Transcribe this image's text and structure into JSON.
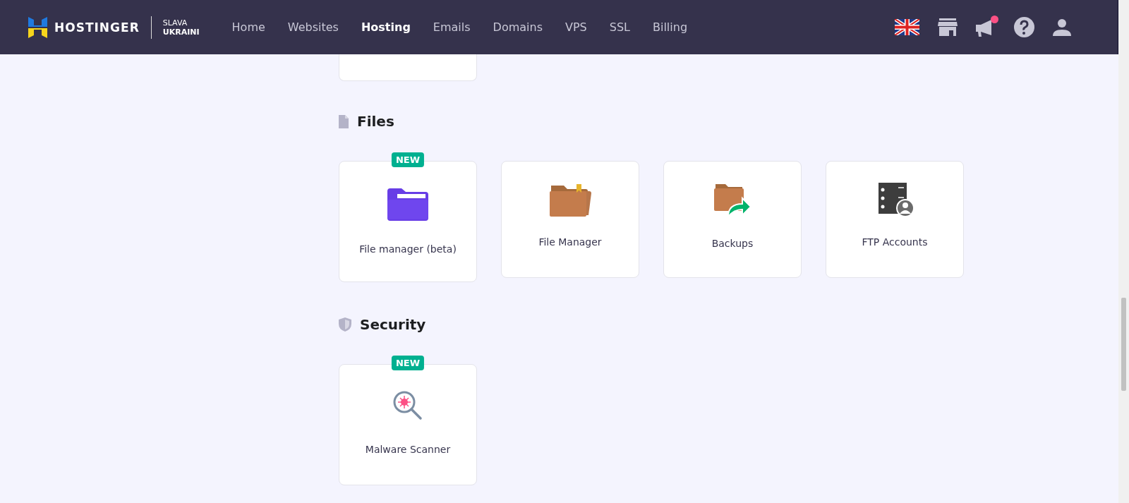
{
  "nav": {
    "brand": "HOSTINGER",
    "tagline_top": "SLAVA",
    "tagline_bottom": "UKRAINI",
    "links": [
      {
        "label": "Home",
        "selected": false
      },
      {
        "label": "Websites",
        "selected": false
      },
      {
        "label": "Hosting",
        "selected": true
      },
      {
        "label": "Emails",
        "selected": false
      },
      {
        "label": "Domains",
        "selected": false
      },
      {
        "label": "VPS",
        "selected": false
      },
      {
        "label": "SSL",
        "selected": false
      },
      {
        "label": "Billing",
        "selected": false
      }
    ],
    "notification_dot": true
  },
  "sections": [
    {
      "title": "Files",
      "kind": "file",
      "cards": [
        {
          "label": "File manager (beta)",
          "kind": "purple",
          "badge": "NEW"
        },
        {
          "label": "File Manager",
          "kind": "folder"
        },
        {
          "label": "Backups",
          "kind": "backup"
        },
        {
          "label": "FTP Accounts",
          "kind": "server"
        }
      ]
    },
    {
      "title": "Security",
      "kind": "shield",
      "cards": [
        {
          "label": "Malware Scanner",
          "kind": "scanner",
          "badge": "NEW"
        }
      ]
    }
  ]
}
